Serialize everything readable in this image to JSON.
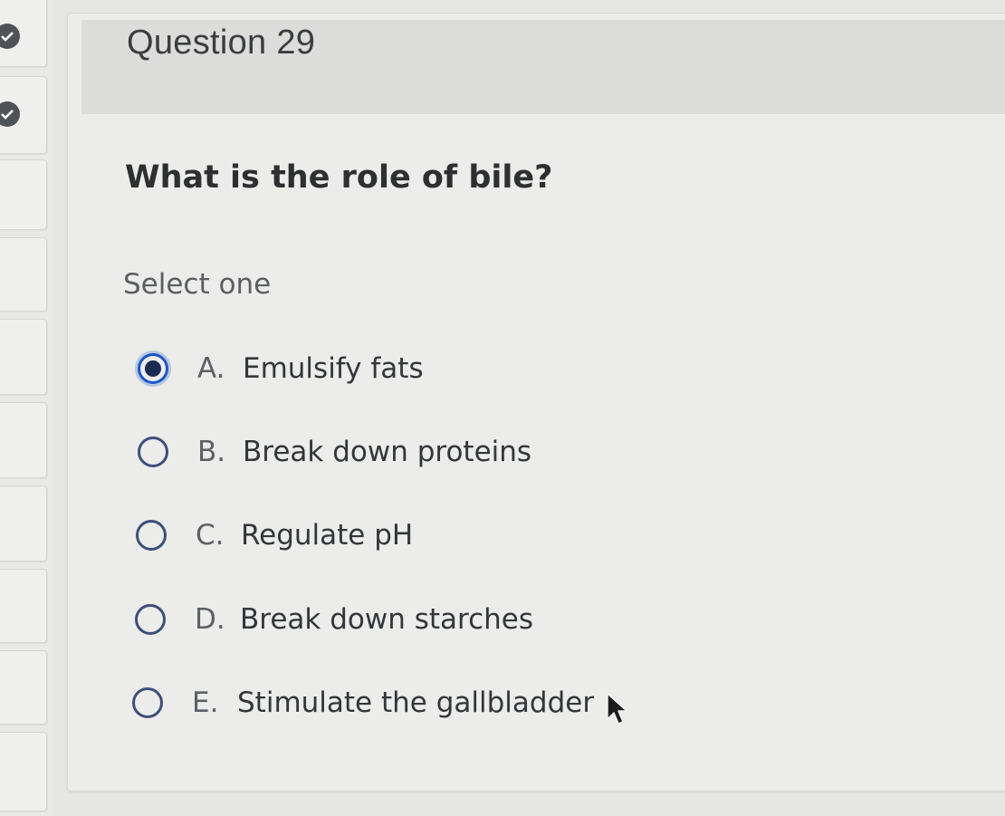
{
  "question": {
    "title": "Question 29",
    "text": "What is the role of bile?",
    "instruction": "Select one",
    "selected": "A",
    "options": [
      {
        "letter": "A.",
        "text": "Emulsify fats",
        "checked": true
      },
      {
        "letter": "B.",
        "text": "Break down proteins",
        "checked": false
      },
      {
        "letter": "C.",
        "text": "Regulate pH",
        "checked": false
      },
      {
        "letter": "D.",
        "text": "Break down starches",
        "checked": false
      },
      {
        "letter": "E.",
        "text": "Stimulate the gallbladder",
        "checked": false
      }
    ]
  },
  "nav": {
    "answered_icon": "check-icon"
  },
  "colors": {
    "radio_border": "#3d4f7a",
    "radio_selected": "#1a56c9",
    "radio_dot": "#1a2a50"
  }
}
